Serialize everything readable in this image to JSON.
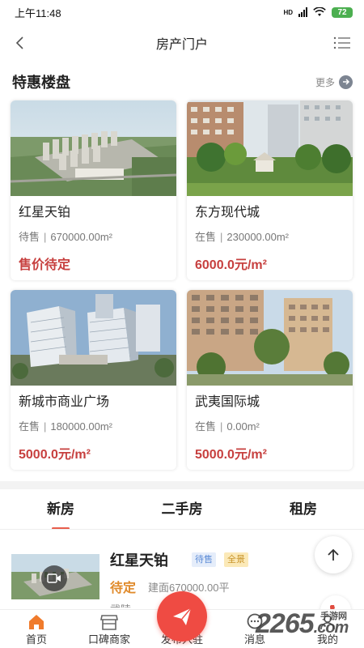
{
  "status_bar": {
    "time": "上午11:48",
    "network": "HD",
    "battery": "72"
  },
  "nav": {
    "title": "房产门户"
  },
  "section": {
    "title": "特惠楼盘",
    "more": "更多"
  },
  "cards": [
    {
      "name": "红星天铂",
      "status": "待售",
      "area": "670000.00m²",
      "price": "售价待定"
    },
    {
      "name": "东方现代城",
      "status": "在售",
      "area": "230000.00m²",
      "price": "6000.0元/m²"
    },
    {
      "name": "新城市商业广场",
      "status": "在售",
      "area": "180000.00m²",
      "price": "5000.0元/m²"
    },
    {
      "name": "武夷国际城",
      "status": "在售",
      "area": "0.00m²",
      "price": "5000.0元/m²"
    }
  ],
  "tabs": [
    {
      "label": "新房",
      "active": true
    },
    {
      "label": "二手房",
      "active": false
    },
    {
      "label": "租房",
      "active": false
    }
  ],
  "listing": {
    "name": "红星天铂",
    "tags": [
      "待售",
      "全景"
    ],
    "status": "待定",
    "area": "建面670000.00平",
    "more": "武陵 ·"
  },
  "bottom_nav": [
    {
      "label": "首页",
      "icon": "home-icon",
      "active": true
    },
    {
      "label": "口碑商家",
      "icon": "shop-icon",
      "active": false
    },
    {
      "label": "发布入驻",
      "icon": "paper-plane-icon",
      "active": false
    },
    {
      "label": "消息",
      "icon": "message-icon",
      "active": false
    },
    {
      "label": "我的",
      "icon": "user-icon",
      "active": false
    }
  ],
  "watermark": {
    "text": "2265",
    "suffix": ".com",
    "small": "手游网"
  },
  "colors": {
    "accent": "#ef4b43",
    "price": "#c7403f",
    "pending": "#e08a2a",
    "home_active": "#f07b2c"
  }
}
